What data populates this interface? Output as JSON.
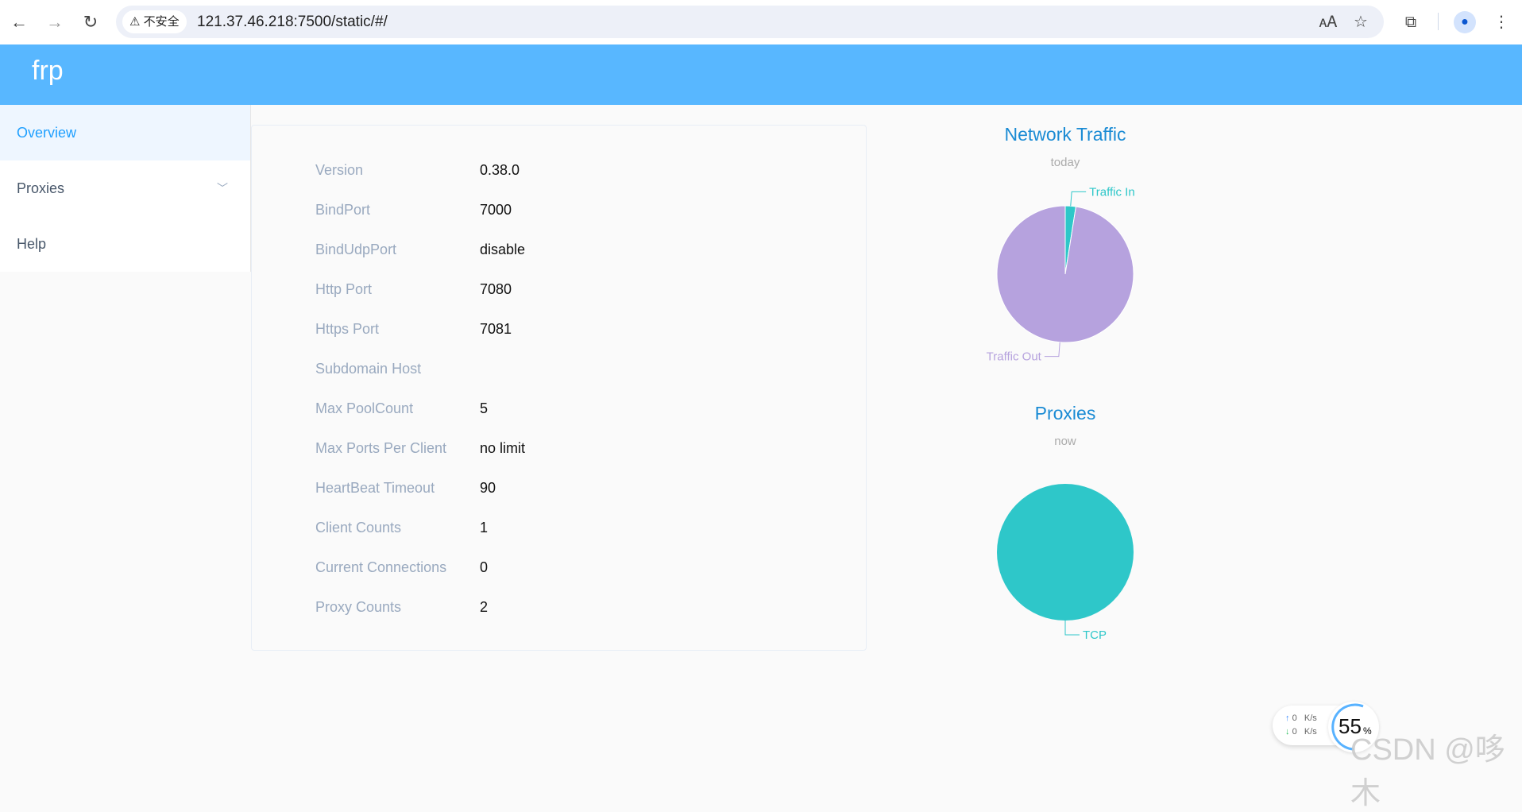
{
  "browser": {
    "security_label": "不安全",
    "url": "121.37.46.218:7500/static/#/",
    "icons": [
      "back-icon",
      "forward-icon",
      "reload-icon",
      "translate-icon",
      "star-icon",
      "extensions-icon",
      "profile-icon",
      "menu-icon"
    ]
  },
  "app": {
    "title": "frp",
    "accent": "#58b7ff"
  },
  "sidebar": {
    "items": [
      {
        "label": "Overview",
        "active": true
      },
      {
        "label": "Proxies",
        "expandable": true
      },
      {
        "label": "Help"
      }
    ]
  },
  "overview": {
    "rows": [
      {
        "label": "Version",
        "value": "0.38.0"
      },
      {
        "label": "BindPort",
        "value": "7000"
      },
      {
        "label": "BindUdpPort",
        "value": "disable"
      },
      {
        "label": "Http Port",
        "value": "7080"
      },
      {
        "label": "Https Port",
        "value": "7081"
      },
      {
        "label": "Subdomain Host",
        "value": ""
      },
      {
        "label": "Max PoolCount",
        "value": "5"
      },
      {
        "label": "Max Ports Per Client",
        "value": "no limit"
      },
      {
        "label": "HeartBeat Timeout",
        "value": "90"
      },
      {
        "label": "Client Counts",
        "value": "1"
      },
      {
        "label": "Current Connections",
        "value": "0"
      },
      {
        "label": "Proxy Counts",
        "value": "2"
      }
    ]
  },
  "chart_data": [
    {
      "type": "pie",
      "title": "Network Traffic",
      "subtitle": "today",
      "slices": [
        {
          "label": "Traffic In",
          "percent": 2.5,
          "color": "#2ec7c9"
        },
        {
          "label": "Traffic Out",
          "percent": 97.5,
          "color": "#b6a2de"
        }
      ]
    },
    {
      "type": "pie",
      "title": "Proxies",
      "subtitle": "now",
      "slices": [
        {
          "label": "TCP",
          "percent": 100,
          "color": "#2ec7c9"
        }
      ]
    }
  ],
  "widget": {
    "up": "0",
    "down": "0",
    "unit": "K/s",
    "percent": "55",
    "percent_sign": "%"
  },
  "watermark": "CSDN @哆木"
}
